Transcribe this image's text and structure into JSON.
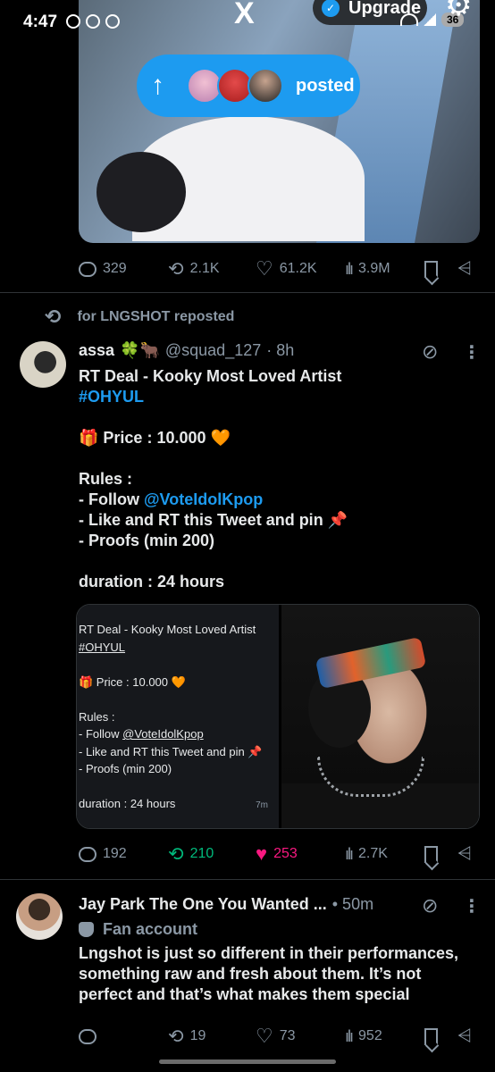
{
  "statusbar": {
    "time": "4:47",
    "app_logo": "X",
    "upgrade_label": "Upgrade",
    "battery": "36"
  },
  "posted_pill": {
    "label": "posted"
  },
  "tweet1": {
    "stats": {
      "replies": "329",
      "reposts": "2.1K",
      "likes": "61.2K",
      "views": "3.9M"
    }
  },
  "tweet2": {
    "repost_label": "for LNGSHOT reposted",
    "name": "assa",
    "name_emoji": "🍀🐂",
    "handle": "@squad_127",
    "time": "· 8h",
    "body": {
      "line1": "RT Deal - Kooky Most Loved Artist",
      "line2": "#OHYUL",
      "line3": "🎁 Price : 10.000 🧡",
      "line4": "Rules :",
      "line5_prefix": "- Follow ",
      "line5_link": "@VoteIdolKpop",
      "line6": "- Like and RT this Tweet and pin 📌",
      "line7": "- Proofs (min 200)",
      "line8": "duration : 24 hours"
    },
    "media_text": {
      "l1": "RT Deal - Kooky Most Loved Artist",
      "l2": "#OHYUL",
      "l3": "🎁 Price : 10.000 🧡",
      "l4": "Rules :",
      "l5_prefix": "- Follow ",
      "l5_link": "@VoteIdolKpop",
      "l6": "- Like and RT this Tweet and pin 📌",
      "l7": "- Proofs (min 200)",
      "l8": "duration : 24 hours",
      "stamp": "7m"
    },
    "stats": {
      "replies": "192",
      "reposts": "210",
      "likes": "253",
      "views": "2.7K"
    }
  },
  "tweet3": {
    "name": "Jay Park The One You Wanted ...",
    "time": "• 50m",
    "badge": "Fan account",
    "body": {
      "line1": "Lngshot is just so different in their performances,",
      "line2": "something raw and fresh about them. It’s not",
      "line3": "perfect and that’s what makes them special"
    },
    "stats": {
      "replies": "",
      "reposts": "19",
      "likes": "73",
      "views": "952"
    }
  },
  "icons": {
    "reply": "reply-icon",
    "repost": "repost-icon",
    "like": "heart-icon",
    "views": "views-icon",
    "bookmark": "bookmark-icon",
    "share": "share-icon",
    "grok": "grok-icon",
    "more": "more-icon"
  },
  "colors": {
    "accent": "#1d9bf0",
    "repost_active": "#00ba7c",
    "like_active": "#f91880",
    "muted": "#8b98a5"
  }
}
